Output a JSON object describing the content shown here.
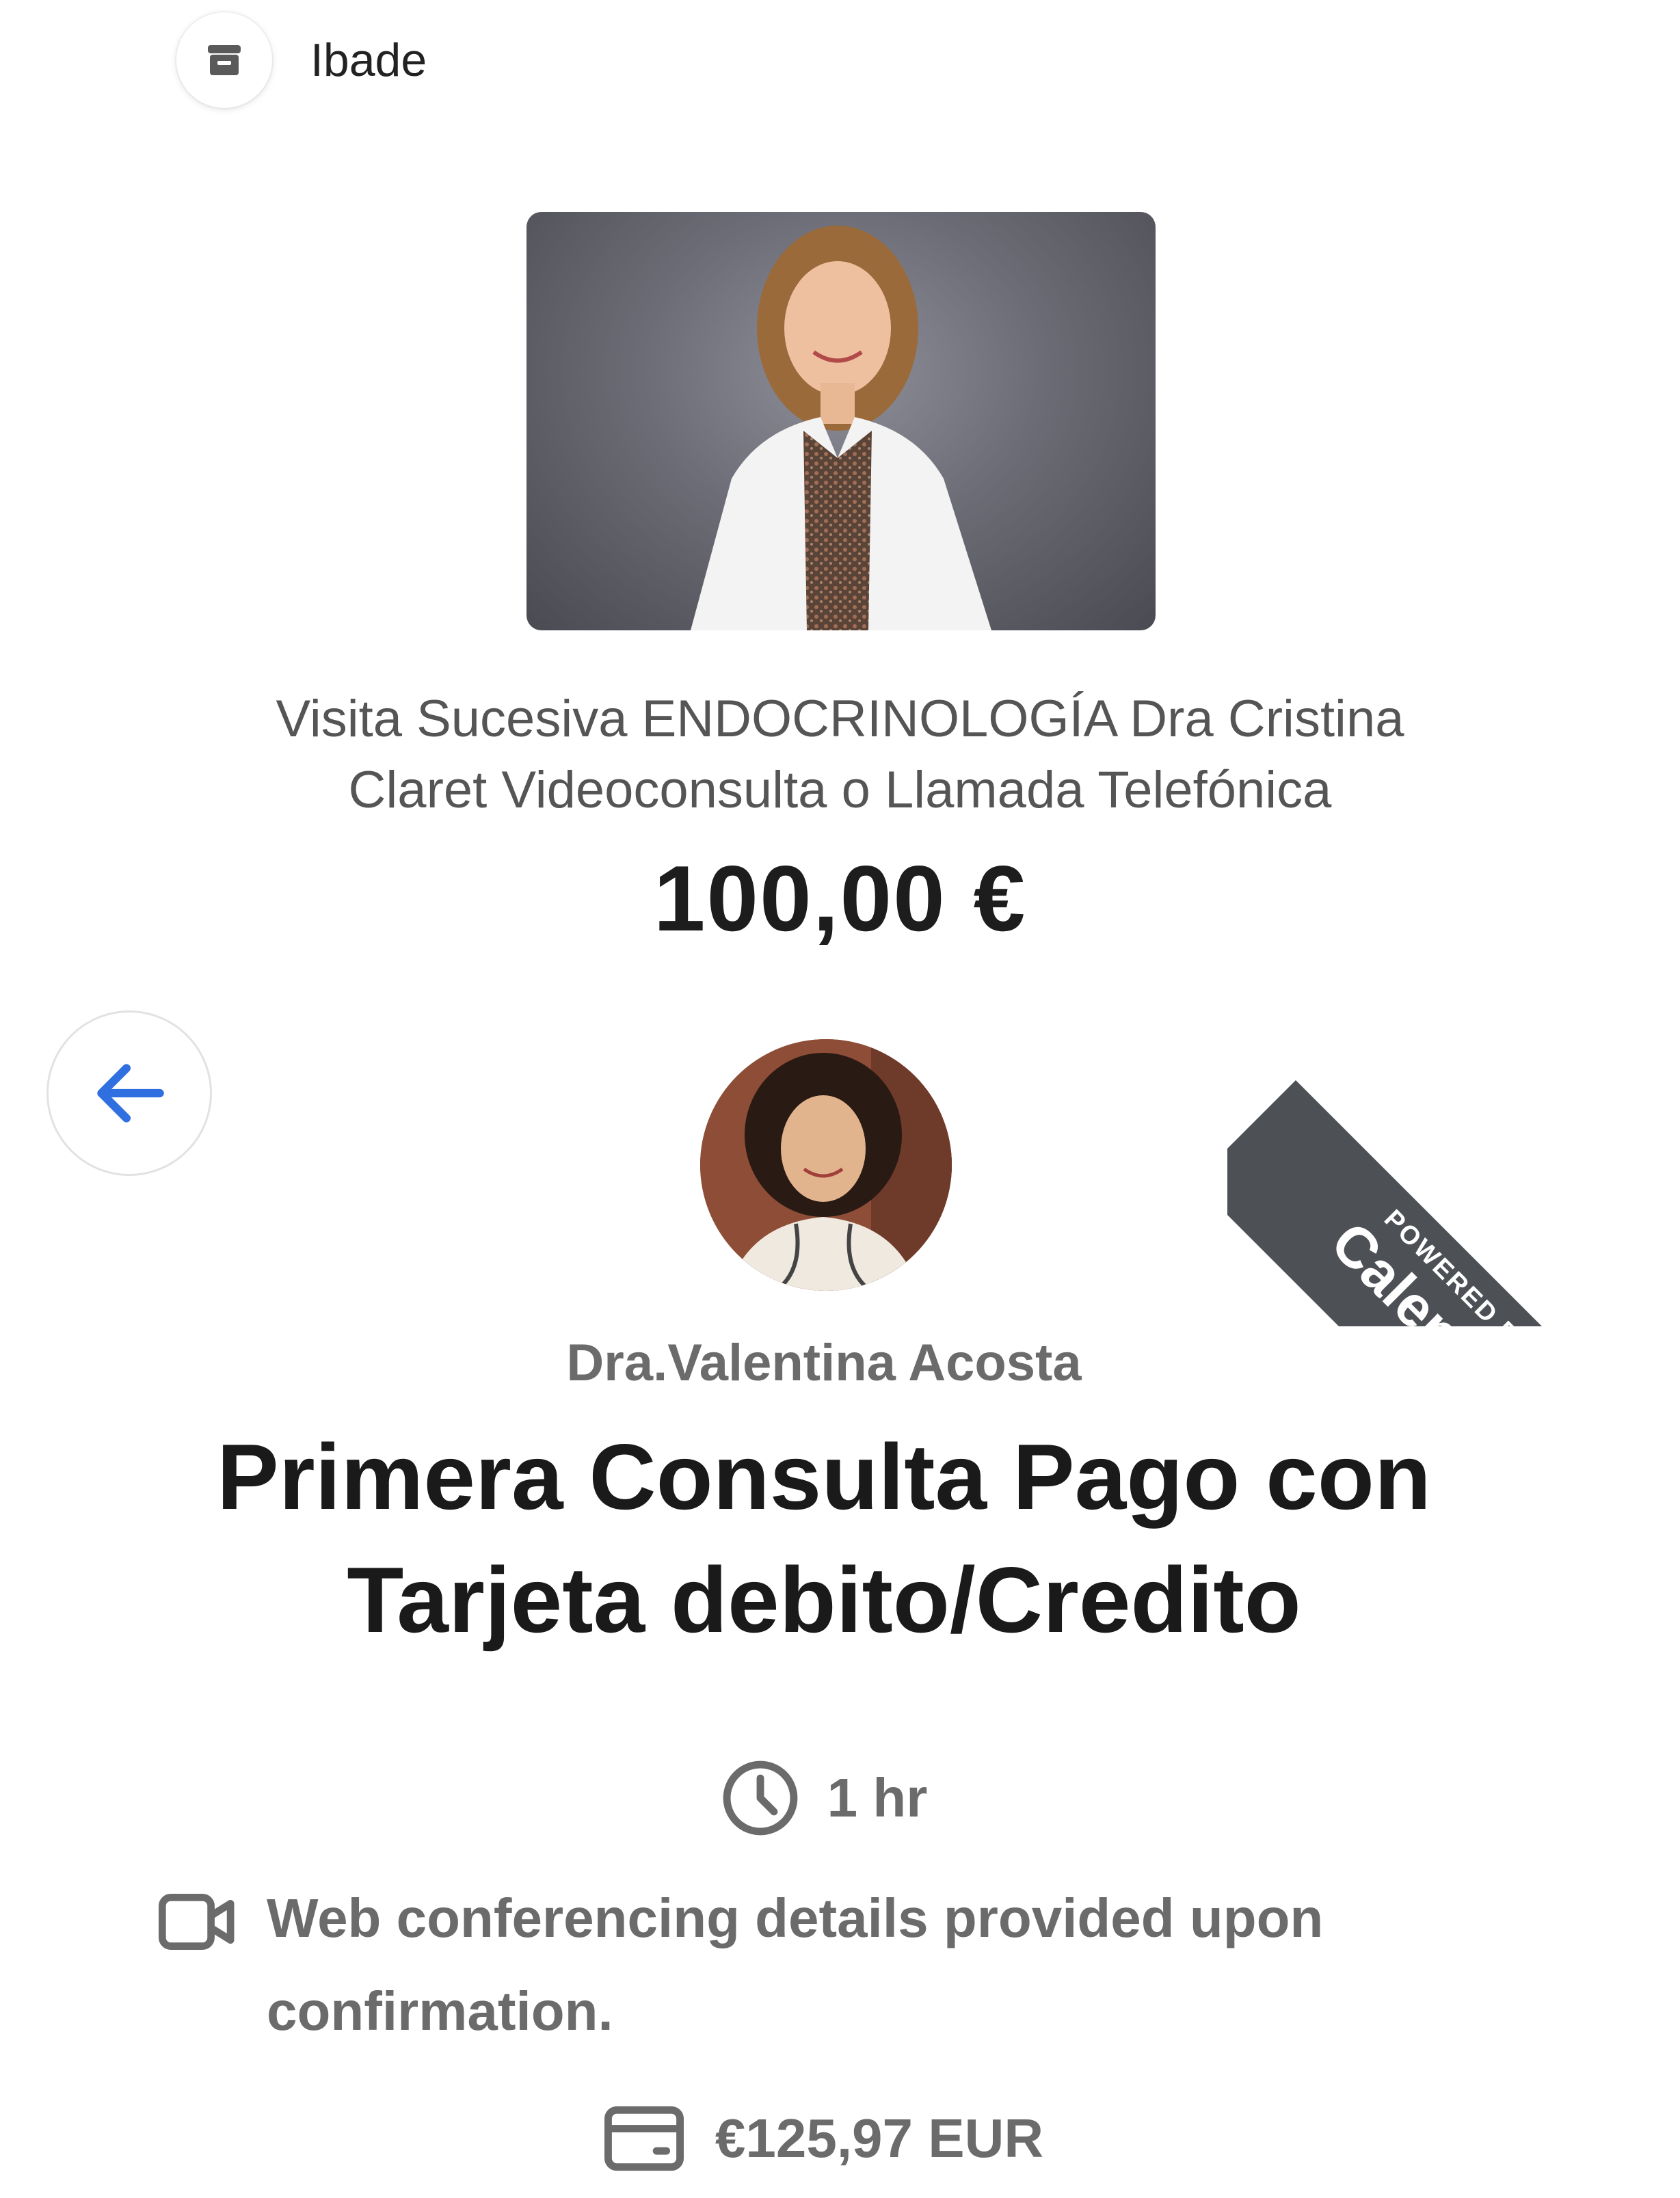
{
  "merchant": {
    "name": "Ibade",
    "icon": "store-icon"
  },
  "product": {
    "title_line1": "Visita Sucesiva ENDOCRINOLOGÍA Dra Cristina",
    "title_line2": "Claret Videoconsulta o Llamada Telefónica",
    "price": "100,00 €"
  },
  "navigation": {
    "back_icon": "arrow-left-icon",
    "accent": "#2f6fe0"
  },
  "ribbon": {
    "small_text": "POWERED BY",
    "brand_text": "Calendly",
    "color": "#4d5055"
  },
  "event": {
    "host": "Dra.Valentina Acosta",
    "title_line1": "Primera Consulta Pago con",
    "title_line2": "Tarjeta debito/Credito",
    "duration": "1 hr",
    "location_line1": "Web conferencing details provided upon",
    "location_line2": "confirmation.",
    "price": "€125,97 EUR"
  }
}
